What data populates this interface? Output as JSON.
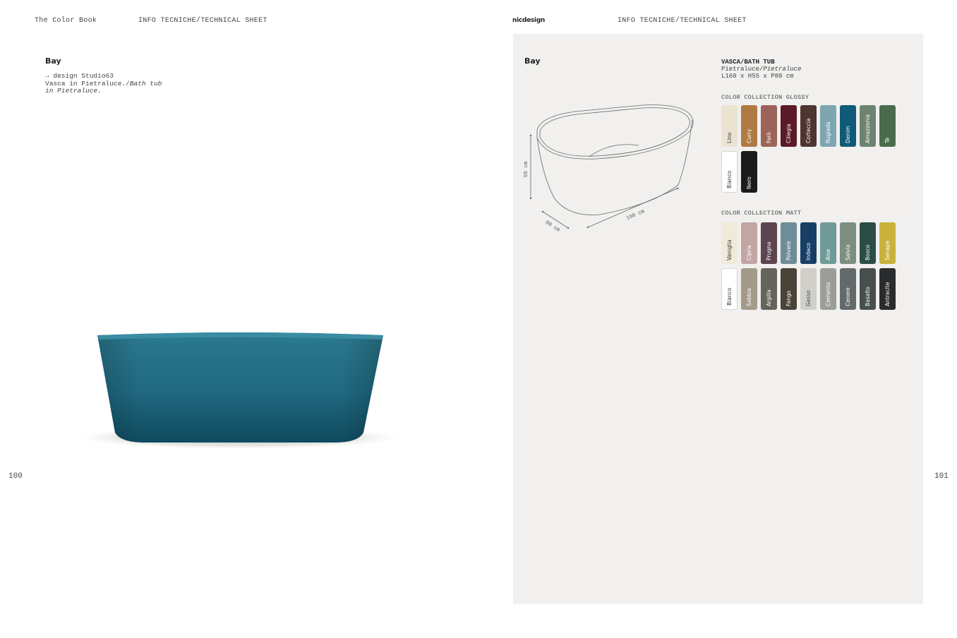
{
  "left_page": {
    "header_left": "The Color Book",
    "header_section": "INFO TECNICHE/TECHNICAL SHEET",
    "product_name": "Bay",
    "designer": "→ design Studio63",
    "desc_line1": "Vasca in Pietraluce./",
    "desc_line1_italic": "Bath tub",
    "desc_line2_italic": "in Pietraluce.",
    "page_number": "100"
  },
  "right_page": {
    "brand": "nicdesign",
    "header_section": "INFO TECNICHE/TECHNICAL SHEET",
    "product_name": "Bay",
    "page_number": "101",
    "drawing": {
      "height_label": "55 cm",
      "depth_label": "80 cm",
      "length_label": "160 cm"
    },
    "specs": {
      "type": "VASCA/BATH TUB",
      "material_it": "Pietraluce/",
      "material_en": "Pietraluce",
      "dimensions": "L160 x H55 x P80 cm"
    },
    "glossy": {
      "label": "COLOR COLLECTION GLOSSY",
      "rows": [
        [
          {
            "name": "Lino",
            "color": "#ece3d2",
            "text": "#333333"
          },
          {
            "name": "Curry",
            "color": "#b07a43",
            "text": "#ffffff"
          },
          {
            "name": "Farò",
            "color": "#9c6458",
            "text": "#ffffff"
          },
          {
            "name": "Ciliegia",
            "color": "#5b1a28",
            "text": "#ffffff"
          },
          {
            "name": "Corteccia",
            "color": "#4e3531",
            "text": "#ffffff"
          },
          {
            "name": "Rugiada",
            "color": "#7ea6b0",
            "text": "#ffffff"
          },
          {
            "name": "Denim",
            "color": "#0f5a78",
            "text": "#ffffff"
          },
          {
            "name": "Amazzonia",
            "color": "#6c8470",
            "text": "#ffffff"
          },
          {
            "name": "Tè",
            "color": "#4a6b4c",
            "text": "#ffffff"
          }
        ],
        [
          {
            "name": "Bianco",
            "color": "#ffffff",
            "text": "#333333"
          },
          {
            "name": "Nero",
            "color": "#1b1b1b",
            "text": "#ffffff"
          }
        ]
      ]
    },
    "matt": {
      "label": "COLOR COLLECTION MATT",
      "rows": [
        [
          {
            "name": "Vaniglia",
            "color": "#f1ead9",
            "text": "#333333"
          },
          {
            "name": "Cipria",
            "color": "#c3a6a4",
            "text": "#ffffff"
          },
          {
            "name": "Prugna",
            "color": "#5c4550",
            "text": "#ffffff"
          },
          {
            "name": "Polvere",
            "color": "#6f8d98",
            "text": "#ffffff"
          },
          {
            "name": "Indaco",
            "color": "#173f66",
            "text": "#ffffff"
          },
          {
            "name": "Aloe",
            "color": "#6f9a96",
            "text": "#ffffff"
          },
          {
            "name": "Salvia",
            "color": "#7b8f80",
            "text": "#ffffff"
          },
          {
            "name": "Bosco",
            "color": "#2a4e45",
            "text": "#ffffff"
          },
          {
            "name": "Senape",
            "color": "#c8b23c",
            "text": "#ffffff"
          }
        ],
        [
          {
            "name": "Bianco",
            "color": "#ffffff",
            "text": "#333333"
          },
          {
            "name": "Sabbia",
            "color": "#a39a89",
            "text": "#ffffff"
          },
          {
            "name": "Argilla",
            "color": "#65645c",
            "text": "#ffffff"
          },
          {
            "name": "Fango",
            "color": "#4a4338",
            "text": "#ffffff"
          },
          {
            "name": "Gesso",
            "color": "#d0cfc9",
            "text": "#444444"
          },
          {
            "name": "Cemento",
            "color": "#9b9e98",
            "text": "#ffffff"
          },
          {
            "name": "Cenere",
            "color": "#636a6b",
            "text": "#ffffff"
          },
          {
            "name": "Basalto",
            "color": "#47504f",
            "text": "#ffffff"
          },
          {
            "name": "Antracite",
            "color": "#2a2b2c",
            "text": "#ffffff"
          }
        ]
      ]
    }
  }
}
